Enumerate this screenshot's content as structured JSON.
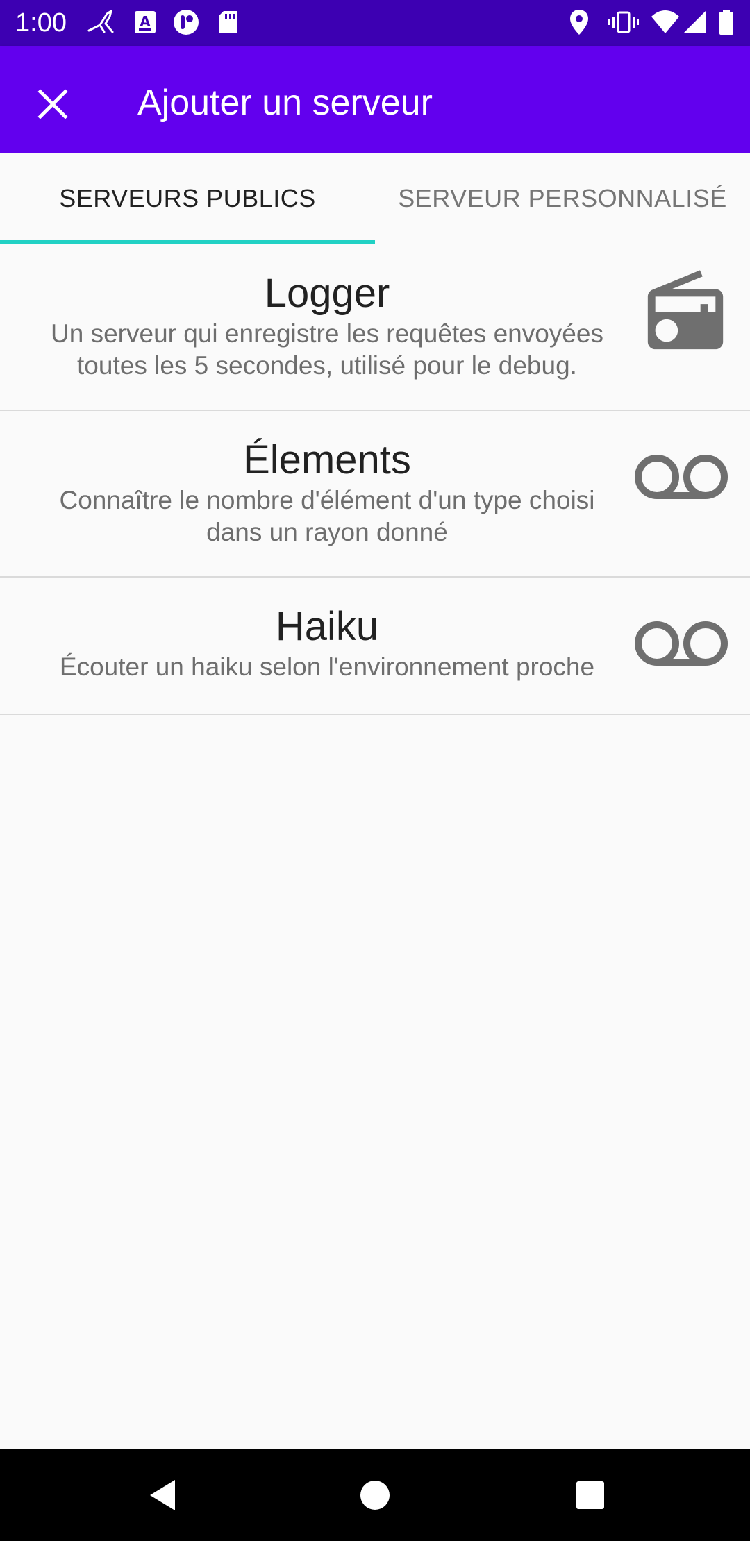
{
  "status_bar": {
    "time": "1:00",
    "left_icons": [
      "bird-notification-icon",
      "font-a-notification-icon",
      "app-notification-icon",
      "sd-card-icon"
    ],
    "right_icons": [
      "location-icon",
      "vibrate-icon",
      "wifi-icon",
      "signal-icon",
      "battery-icon"
    ]
  },
  "app_bar": {
    "title": "Ajouter un serveur",
    "close_icon": "close-icon",
    "background_color": "#6200EE"
  },
  "tabs": [
    {
      "label": "SERVEURS PUBLICS",
      "selected": true
    },
    {
      "label": "SERVEUR PERSONNALISÉ",
      "selected": false
    }
  ],
  "accent_color": "#21D1C4",
  "servers": [
    {
      "name": "Logger",
      "description_lines": [
        "Un serveur qui enregistre les requêtes envoyées",
        "toutes les 5 secondes, utilisé pour le debug."
      ],
      "icon": "radio-icon"
    },
    {
      "name": "Élements",
      "description_lines": [
        "Connaître le nombre d'élément d'un type choisi",
        "dans un rayon donné"
      ],
      "icon": "voicemail-icon"
    },
    {
      "name": "Haiku",
      "description_lines": [
        "Écouter un haiku selon l'environnement proche"
      ],
      "icon": "voicemail-icon"
    }
  ],
  "nav_bar": {
    "buttons": [
      "back-icon",
      "home-icon",
      "recents-icon"
    ]
  }
}
